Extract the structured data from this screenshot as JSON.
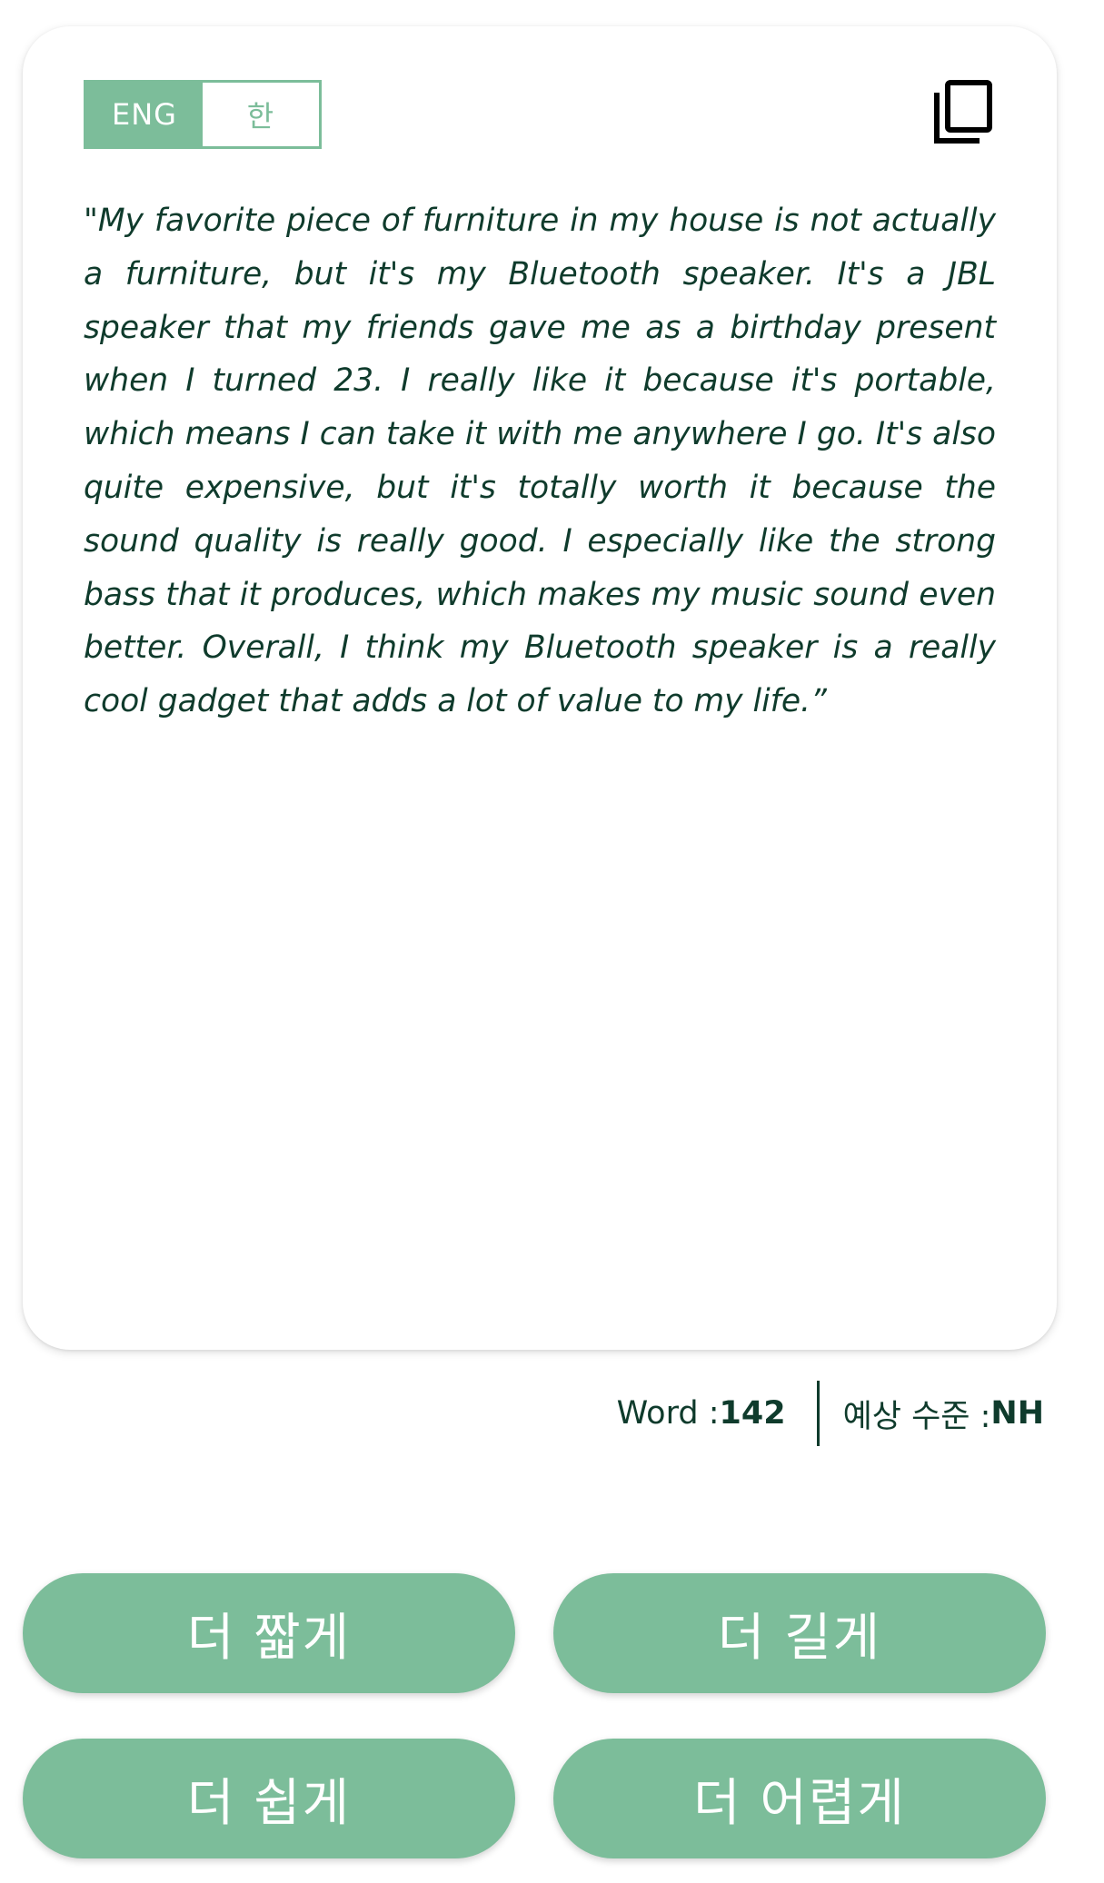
{
  "language_toggle": {
    "options": [
      {
        "label": "ENG",
        "active": true
      },
      {
        "label": "한",
        "active": false
      }
    ]
  },
  "copy_button": {
    "icon": "copy-icon"
  },
  "passage": {
    "text": "\"My favorite piece of furniture in my house is not actually a furniture, but it's my Bluetooth speaker. It's a JBL speaker that my friends gave me as a birthday present when I turned 23. I really like it because it's portable, which means I can take it with me anywhere I go. It's also quite expensive, but it's totally worth it because the sound quality is really good. I especially like the strong bass that it produces, which makes my music sound even better. Overall, I think my Bluetooth speaker is a really cool gadget that adds a lot of value to my life.”"
  },
  "stats": {
    "word_label": "Word : ",
    "word_count": "142",
    "level_label": "예상 수준 : ",
    "level_value": "NH"
  },
  "actions": {
    "shorter": "더 짧게",
    "longer": "더 길게",
    "easier": "더 쉽게",
    "harder": "더 어렵게"
  },
  "colors": {
    "accent": "#7cbd9a",
    "text": "#0f3b2c",
    "background": "#ffffff"
  }
}
